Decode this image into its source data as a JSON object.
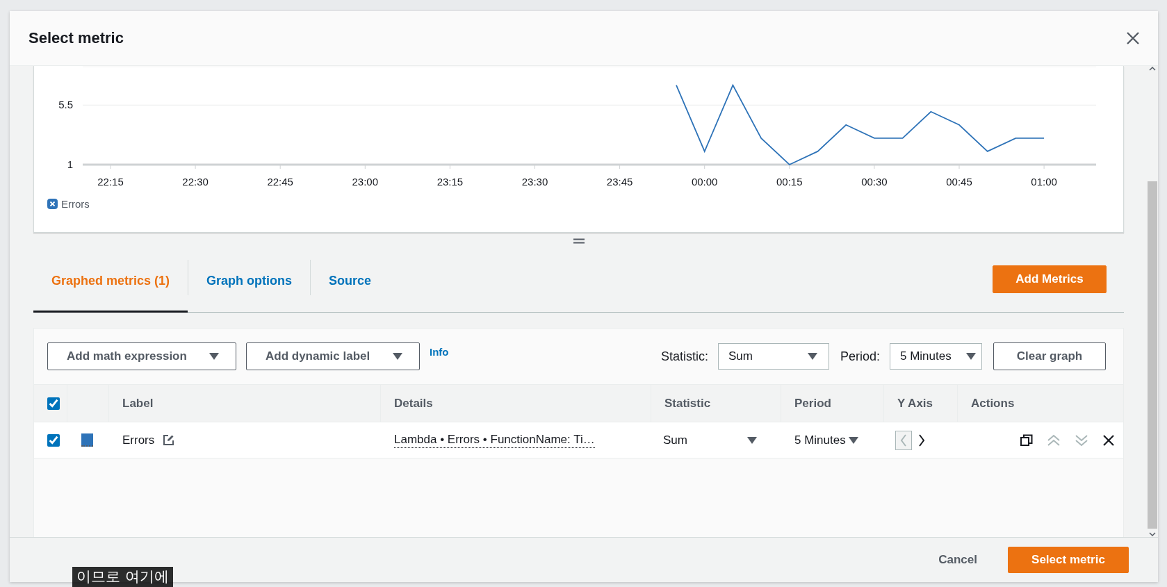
{
  "dialog": {
    "title": "Select metric"
  },
  "chart": {
    "chart_data": {
      "type": "line",
      "categories": [
        "22:15",
        null,
        null,
        "22:30",
        null,
        null,
        "22:45",
        null,
        null,
        "23:00",
        null,
        null,
        "23:15",
        null,
        null,
        "23:30",
        null,
        null,
        "23:45",
        null,
        null,
        "00:00",
        null,
        null,
        "00:15",
        null,
        null,
        "00:30",
        null,
        null,
        "00:45",
        null,
        null,
        "01:00"
      ],
      "series": [
        {
          "name": "Errors",
          "color": "#2e73b8",
          "values": [
            null,
            null,
            null,
            null,
            null,
            null,
            null,
            null,
            null,
            null,
            null,
            null,
            null,
            null,
            null,
            null,
            null,
            null,
            null,
            null,
            7,
            2,
            7,
            3,
            1,
            2,
            4,
            3,
            3,
            5,
            4,
            2,
            3,
            3
          ]
        }
      ],
      "yticks": [
        1,
        5.5
      ],
      "ylim": [
        1,
        8.4
      ]
    },
    "legend": [
      {
        "checked": true
      }
    ]
  },
  "tabs": [
    {
      "label": "Graphed metrics (1)",
      "selected": true
    },
    {
      "label": "Graph options",
      "selected": false
    },
    {
      "label": "Source",
      "selected": false
    }
  ],
  "add_metrics_button": "Add Metrics",
  "toolbar": {
    "math_dropdown": "Add math expression",
    "dynamic_label_dropdown": "Add dynamic label",
    "info_link": "Info",
    "statistic_label": "Statistic:",
    "statistic_value": "Sum",
    "period_label": "Period:",
    "period_value": "5 Minutes",
    "clear_button": "Clear graph"
  },
  "table": {
    "select_all_checked": true,
    "columns": [
      "Label",
      "Details",
      "Statistic",
      "Period",
      "Y Axis",
      "Actions"
    ],
    "rows": [
      {
        "checked": true,
        "color": "#2e73b8",
        "label": "Errors",
        "details": "Lambda • Errors • FunctionName: Ti…",
        "statistic": "Sum",
        "period": "5 Minutes",
        "left_axis_selected": true
      }
    ]
  },
  "footer": {
    "cancel": "Cancel",
    "submit": "Select metric"
  },
  "caption": "이므로 여기에"
}
